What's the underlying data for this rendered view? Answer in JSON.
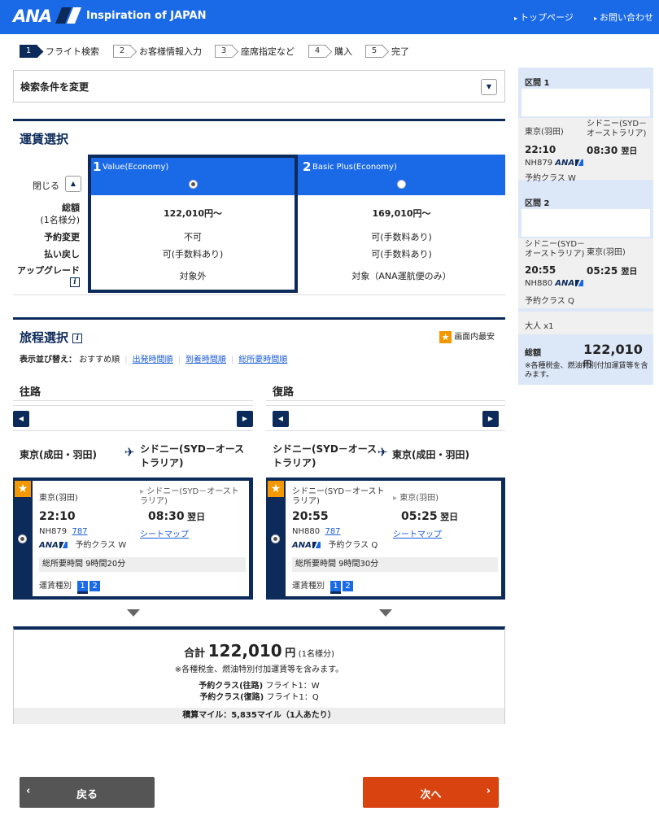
{
  "header": {
    "logo": "ANA",
    "tagline": "Inspiration of JAPAN",
    "links": [
      "トップページ",
      "お問い合わせ"
    ]
  },
  "steps": [
    {
      "num": "1",
      "label": "フライト検索"
    },
    {
      "num": "2",
      "label": "お客様情報入力"
    },
    {
      "num": "3",
      "label": "座席指定など"
    },
    {
      "num": "4",
      "label": "購入"
    },
    {
      "num": "5",
      "label": "完了"
    }
  ],
  "search": {
    "label": "検索条件を変更"
  },
  "fare": {
    "title": "運賃選択",
    "close_label": "閉じる",
    "options": [
      {
        "num": "1",
        "name": "Value(Economy)",
        "total": "122,010円～",
        "change": "不可",
        "refund": "可(手数料あり)",
        "upgrade": "対象外"
      },
      {
        "num": "2",
        "name": "Basic Plus(Economy)",
        "total": "169,010円～",
        "change": "可(手数料あり)",
        "refund": "可(手数料あり)",
        "upgrade": "対象（ANA運航便のみ）"
      }
    ],
    "rows": {
      "total": "総額",
      "total_sub": "(1名様分)",
      "change": "予約変更",
      "refund": "払い戻し",
      "upgrade": "アップグレード"
    }
  },
  "itinerary": {
    "title": "旅程選択",
    "best_label": "画面内最安",
    "sort_label": "表示並び替え：",
    "sort_current": "おすすめ順",
    "sort_links": [
      "出発時間順",
      "到着時間順",
      "総所要時間順"
    ]
  },
  "outbound": {
    "heading": "往路",
    "from": "東京(成田・羽田)",
    "to": "シドニー(SYD－オーストラリア)",
    "card": {
      "dep_city": "東京(羽田)",
      "arr_city": "シドニー(SYD－オーストラリア)",
      "dep_time": "22:10",
      "arr_time": "08:30",
      "next_day": "翌日",
      "flight": "NH879",
      "aircraft": "787",
      "seatmap": "シートマップ",
      "airline": "ANA",
      "class": "予約クラス W",
      "duration": "総所要時間 9時間20分",
      "fare_type_label": "運賃種別",
      "fare_types": [
        "1",
        "2"
      ]
    }
  },
  "inbound": {
    "heading": "復路",
    "from": "シドニー(SYD－オーストラリア)",
    "to": "東京(成田・羽田)",
    "card": {
      "dep_city": "シドニー(SYD－オーストラリア)",
      "arr_city": "東京(羽田)",
      "dep_time": "20:55",
      "arr_time": "05:25",
      "next_day": "翌日",
      "flight": "NH880",
      "aircraft": "787",
      "seatmap": "シートマップ",
      "airline": "ANA",
      "class": "予約クラス Q",
      "duration": "総所要時間 9時間30分",
      "fare_type_label": "運賃種別",
      "fare_types": [
        "1",
        "2"
      ]
    }
  },
  "total": {
    "label": "合計",
    "amount": "122,010",
    "unit": "円",
    "per": "(1名様分)",
    "note": "※各種税金、燃油特別付加運賃等を含みます。",
    "class_out_label": "予約クラス(往路)",
    "class_out": "フライト1：W",
    "class_in_label": "予約クラス(復路)",
    "class_in": "フライト1：Q",
    "miles": "積算マイル：5,835マイル（1人あたり）"
  },
  "sidebar": {
    "seg1": {
      "title": "区間 1",
      "from": "東京(羽田)",
      "to": "シドニー(SYD－オーストラリア)",
      "dep": "22:10",
      "arr": "08:30",
      "next": "翌日",
      "flight": "NH879",
      "class": "予約クラス W"
    },
    "seg2": {
      "title": "区間 2",
      "from": "シドニー(SYD－オーストラリア)",
      "to": "東京(羽田)",
      "dep": "20:55",
      "arr": "05:25",
      "next": "翌日",
      "flight": "NH880",
      "class": "予約クラス Q"
    },
    "pax": "大人 x1",
    "total_label": "総額",
    "total": "122,010",
    "unit": "円",
    "note": "※各種税金、燃油特別付加運賃等を含みます。"
  },
  "buttons": {
    "back": "戻る",
    "next": "次へ"
  },
  "colors": {
    "brand": "#1a6ae8",
    "navy": "#0c2a5a",
    "accent": "#d94310",
    "star": "#f39800"
  }
}
